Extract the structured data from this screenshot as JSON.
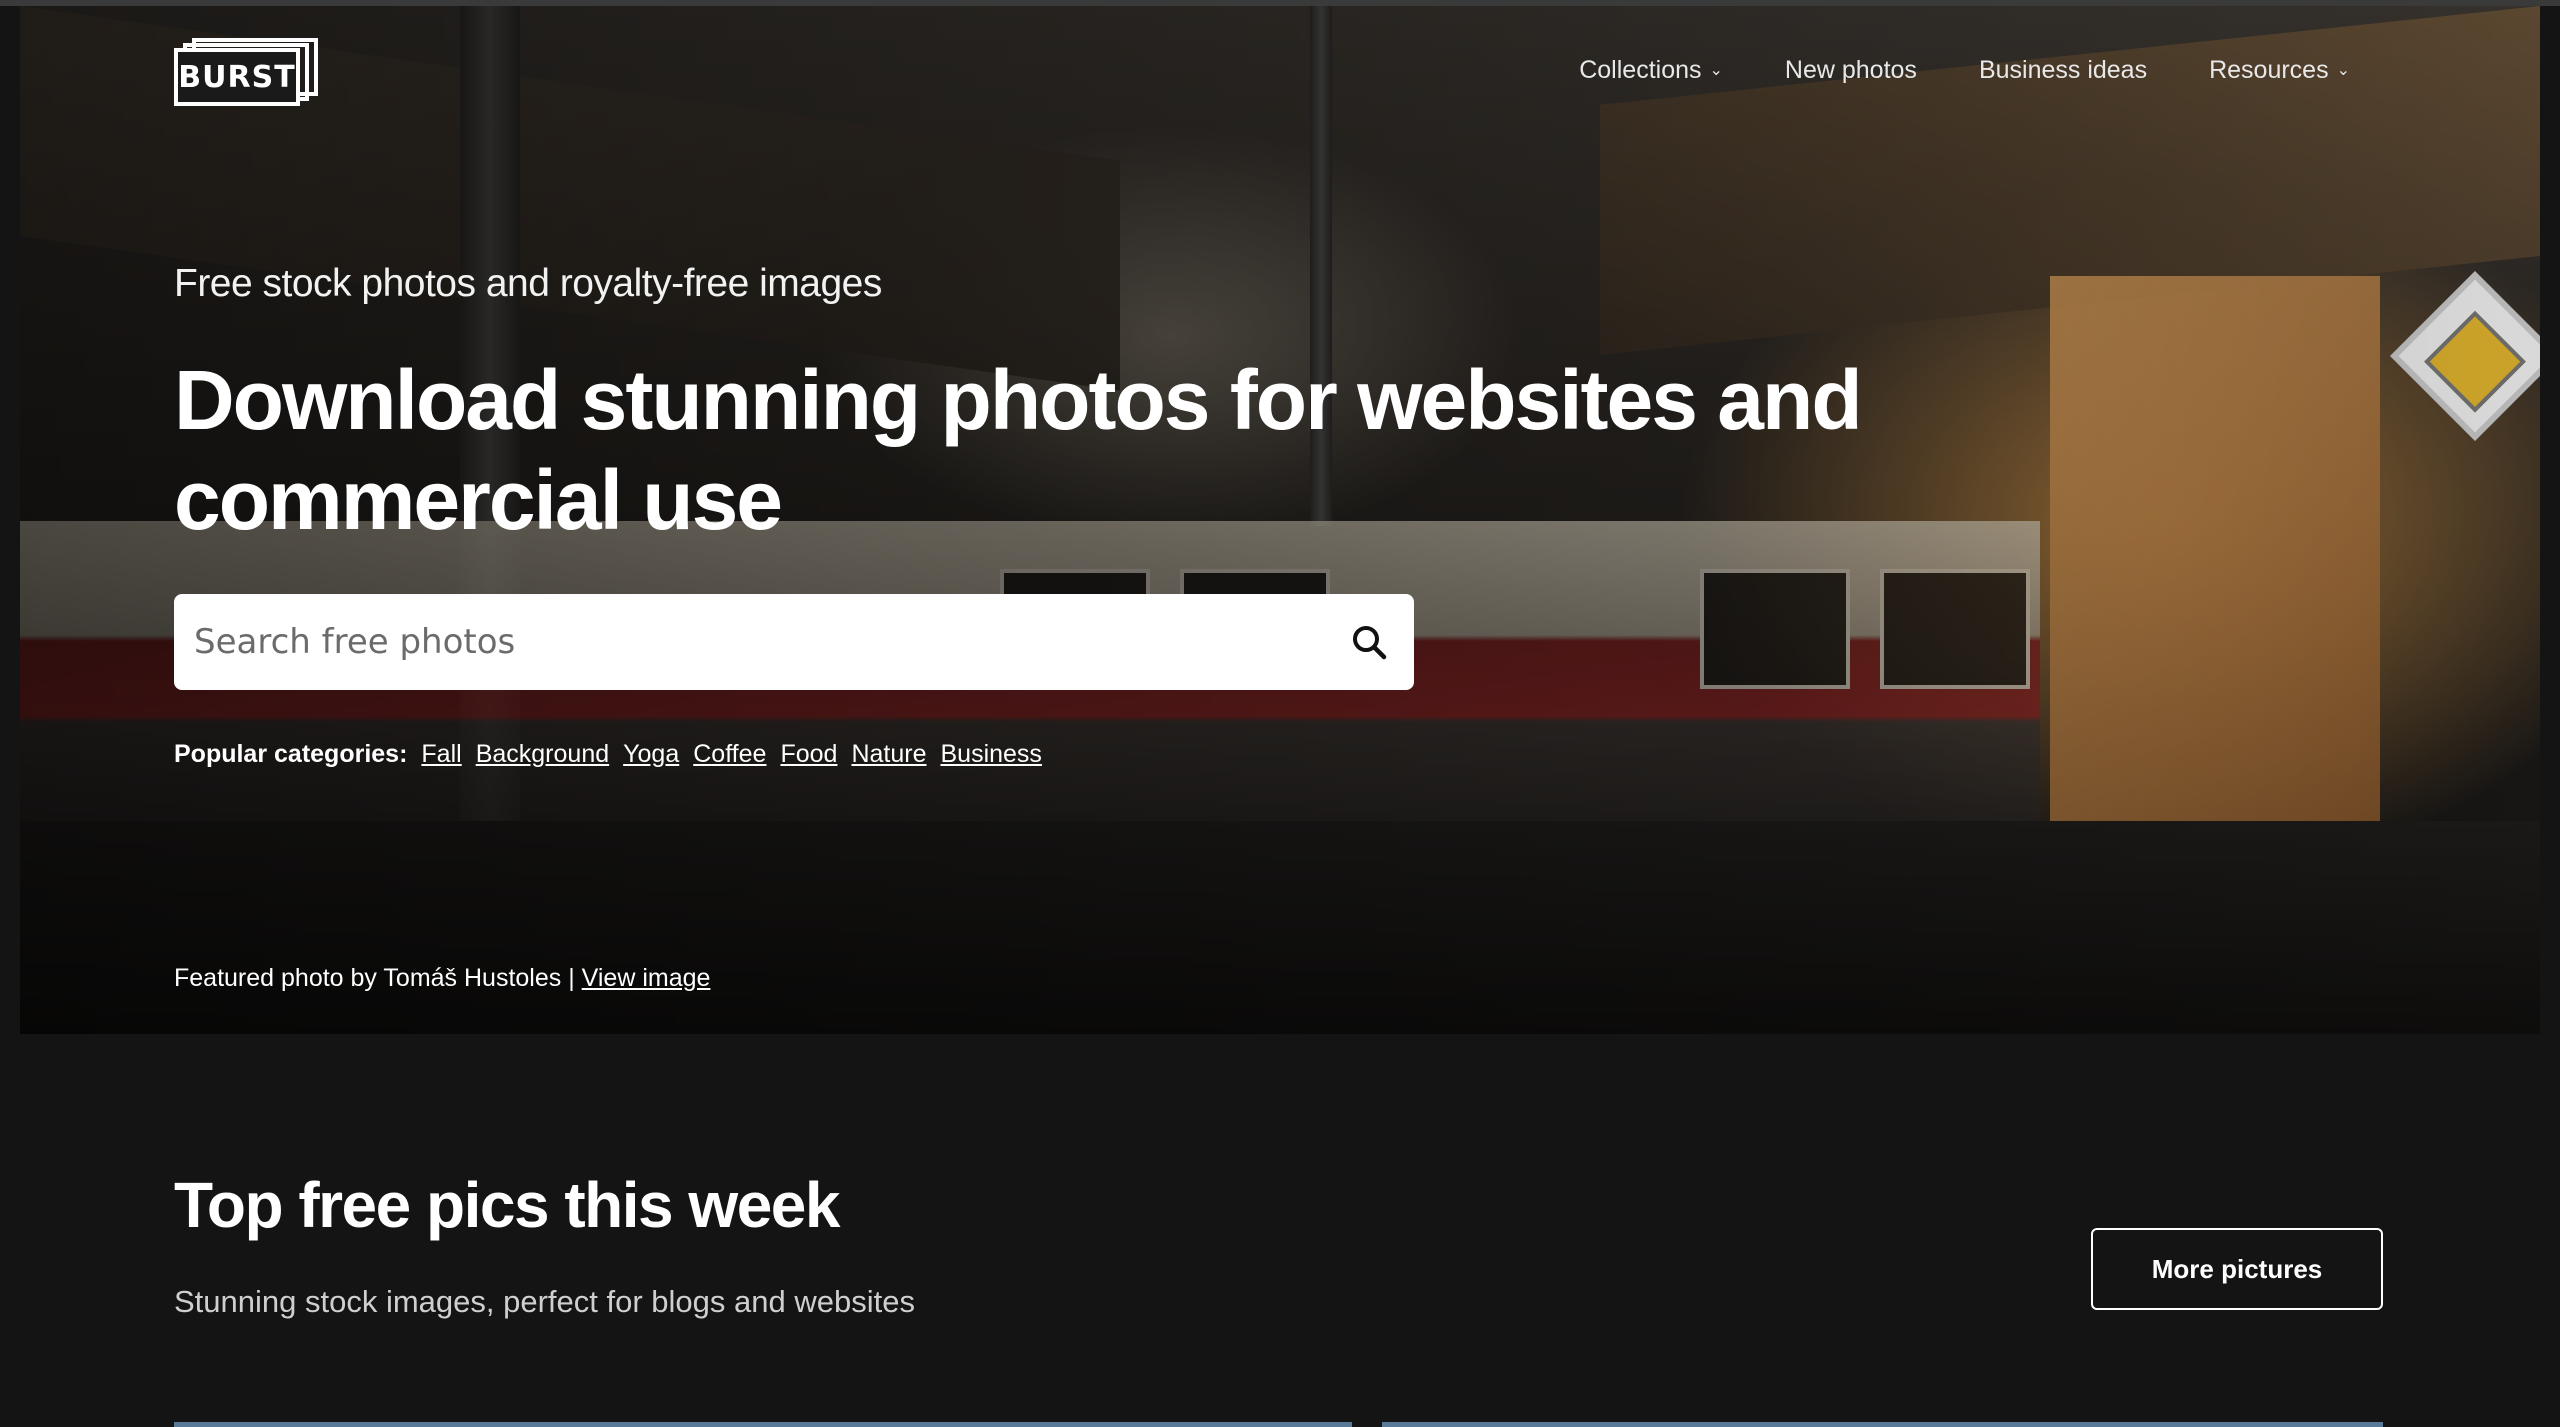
{
  "header": {
    "logo_text": "BURST",
    "nav": [
      {
        "label": "Collections",
        "has_dropdown": true
      },
      {
        "label": "New photos",
        "has_dropdown": false
      },
      {
        "label": "Business ideas",
        "has_dropdown": false
      },
      {
        "label": "Resources",
        "has_dropdown": true
      }
    ]
  },
  "hero": {
    "subtitle": "Free stock photos and royalty-free images",
    "title": "Download stunning photos for websites and commercial use",
    "search_placeholder": "Search free photos",
    "search_icon": "search-icon",
    "popular_label": "Popular categories:",
    "categories": [
      "Fall",
      "Background",
      "Yoga",
      "Coffee",
      "Food",
      "Nature",
      "Business"
    ],
    "featured_prefix": "Featured photo by Tomáš Hustoles |",
    "featured_link": "View image"
  },
  "section": {
    "title": "Top free pics this week",
    "subtitle": "Stunning stock images, perfect for blogs and websites",
    "button": "More pictures"
  },
  "colors": {
    "page_background": "#141414",
    "text": "#ffffff",
    "search_background": "#ffffff"
  }
}
